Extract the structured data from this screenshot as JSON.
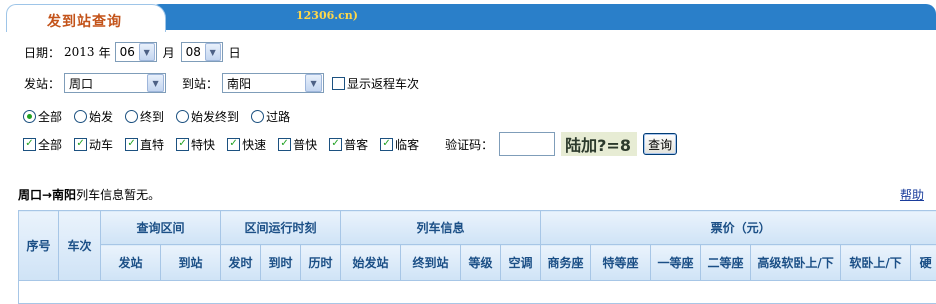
{
  "header": {
    "tab_title": "发到站查询",
    "domain": "12306.cn)"
  },
  "date": {
    "label": "日期：",
    "year": "2013",
    "year_unit": "年",
    "month": "06",
    "month_unit": "月",
    "day": "08",
    "day_unit": "日"
  },
  "stations": {
    "from_label": "发站：",
    "from_value": "周口",
    "to_label": "到站：",
    "to_value": "南阳",
    "return_label": "显示返程车次"
  },
  "radio_options": [
    "全部",
    "始发",
    "终到",
    "始发终到",
    "过路"
  ],
  "train_types": [
    "全部",
    "动车",
    "直特",
    "特快",
    "快速",
    "普快",
    "普客",
    "临客"
  ],
  "captcha": {
    "label": "验证码：",
    "image_text": "陆加?=8",
    "button": "查询"
  },
  "result": {
    "route": "周口→南阳",
    "message": "列车信息暂无。",
    "help": "帮助"
  },
  "table": {
    "col_seq": "序号",
    "col_train": "车次",
    "group_query": "查询区间",
    "group_time": "区间运行时刻",
    "group_train_info": "列车信息",
    "group_price": "票价（元）",
    "sub_headers": [
      "发站",
      "到站",
      "发时",
      "到时",
      "历时",
      "始发站",
      "终到站",
      "等级",
      "空调",
      "商务座",
      "特等座",
      "一等座",
      "二等座",
      "高级软卧上/下",
      "软卧上/下",
      "硬"
    ]
  }
}
